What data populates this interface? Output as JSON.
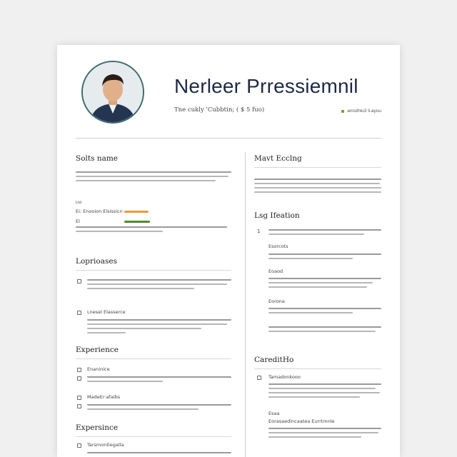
{
  "header": {
    "name": "Nerleer Prressiemnil",
    "subtitle": "Tne cukly 'Cubbtin; ( $ 5 fuo)",
    "contact": "anruthlu3 li.ayuu"
  },
  "left": {
    "skills_heading": "Solts name",
    "skill_labels": [
      "Ei: Enooion Elsissicn",
      "El"
    ],
    "languages_heading": "Loprioases",
    "lang_item_label": "Lnesel Elasserce",
    "experience_heading": "Experience",
    "exp_items": [
      "Enaninice",
      "MadeEr:afaibs"
    ],
    "expertise_heading": "Expersince",
    "expertise_item": "Tarsmontlegalla"
  },
  "right": {
    "work_heading": "Mavt Ecclng",
    "education_heading": "Lsg Ifeation",
    "edu_number": "1",
    "edu_sub": [
      "Esorcots",
      "Eoaod",
      "Eorona"
    ],
    "cert_heading": "CareditHo",
    "cert_items": [
      "Tamadonkooo",
      "Esaa",
      "Eorasaedincaatea Eurrtmnle"
    ]
  },
  "colors": {
    "name": "#1e2a44",
    "bar_orange": "#e89a3a",
    "bar_green": "#4f8a32"
  },
  "icons": [
    "avatar-photo"
  ]
}
